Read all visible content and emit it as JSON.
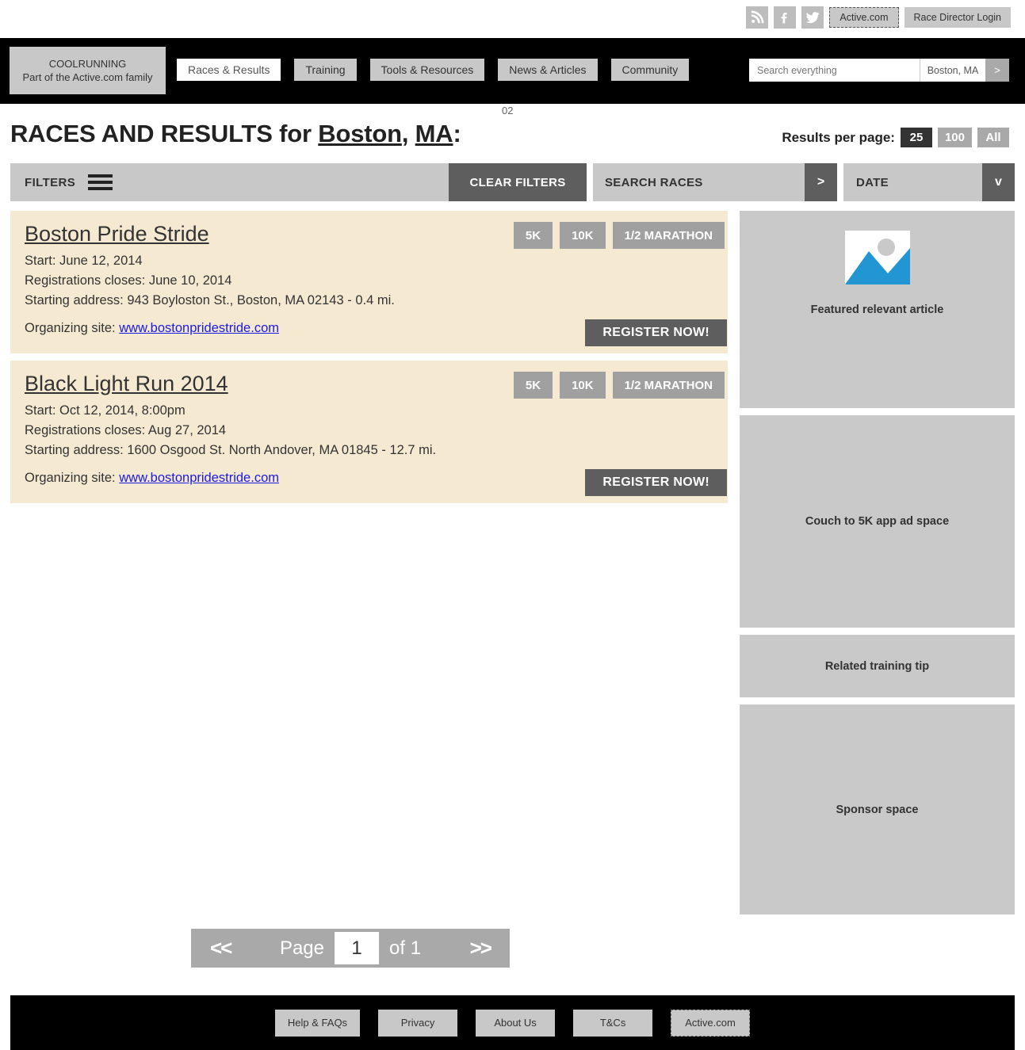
{
  "utility": {
    "social": [
      {
        "name": "rss-icon",
        "label": "RSS"
      },
      {
        "name": "facebook-icon",
        "label": "Facebook"
      },
      {
        "name": "twitter-icon",
        "label": "Twitter"
      }
    ],
    "active_button": "Active.com",
    "race_director_login": "Race Director Login"
  },
  "nav": {
    "logo_line1": "COOLRUNNING",
    "logo_line2": "Part of the Active.com family",
    "items": [
      {
        "label": "Races & Results",
        "active": true
      },
      {
        "label": "Training",
        "active": false
      },
      {
        "label": "Tools & Resources",
        "active": false
      },
      {
        "label": "News & Articles",
        "active": false
      },
      {
        "label": "Community",
        "active": false
      }
    ],
    "artifact_text": "02",
    "search_placeholder": "Search everything",
    "search_value": "",
    "location": "Boston, MA",
    "go_label": ">"
  },
  "header": {
    "title_prefix": "RACES AND RESULTS for ",
    "title_city": "Boston",
    "title_comma": ", ",
    "title_state": "MA",
    "title_suffix": ":",
    "results_per_page_label": "Results per page:",
    "results_per_page_options": [
      {
        "label": "25",
        "selected": true
      },
      {
        "label": "100",
        "selected": false
      },
      {
        "label": "All",
        "selected": false
      }
    ]
  },
  "filters": {
    "filters_label": "FILTERS",
    "clear_filters_label": "CLEAR FILTERS",
    "search_races_label": "SEARCH RACES",
    "search_races_go": ">",
    "date_label": "DATE",
    "date_caret": "v"
  },
  "races": [
    {
      "title": "Boston Pride Stride",
      "start": "Start: June 12, 2014",
      "registration": "Registrations closes: June 10, 2014",
      "address": "Starting address: 943 Boyloston St., Boston, MA 02143 - 0.4 mi.",
      "org_label": "Organizing site: ",
      "org_link": "www.bostonpridestride.com",
      "badges": [
        "5K",
        "10K",
        "1/2 MARATHON"
      ],
      "register_label": "REGISTER NOW!"
    },
    {
      "title": "Black Light Run 2014",
      "start": "Start: Oct 12, 2014, 8:00pm",
      "registration": "Registrations closes: Aug 27, 2014",
      "address": "Starting address: 1600 Osgood St. North Andover, MA 01845 - 12.7 mi.",
      "org_label": "Organizing site: ",
      "org_link": "www.bostonpridestride.com",
      "badges": [
        "5K",
        "10K",
        "1/2 MARATHON"
      ],
      "register_label": "REGISTER NOW!"
    }
  ],
  "sidebar": {
    "panels": [
      {
        "label": "Featured relevant article",
        "type": "article"
      },
      {
        "label": "Couch to 5K app ad space",
        "type": "ad"
      },
      {
        "label": "Related training tip",
        "type": "tip"
      },
      {
        "label": "Sponsor space",
        "type": "sponsor"
      }
    ]
  },
  "pagination": {
    "prev": "<<",
    "page_label": "Page",
    "page_value": "1",
    "of_label": "of  1",
    "next": ">>"
  },
  "footer": {
    "links": [
      {
        "label": "Help & FAQs",
        "dashed": false
      },
      {
        "label": "Privacy",
        "dashed": false
      },
      {
        "label": "About Us",
        "dashed": false
      },
      {
        "label": "T&Cs",
        "dashed": false
      },
      {
        "label": "Active.com",
        "dashed": true
      }
    ]
  },
  "colors": {
    "brand_black": "#000000",
    "card_cream": "#f6e9d2",
    "gray_panel": "#c9c9c9",
    "dark_button": "#5e5e5e",
    "link_blue": "#1a1ae6",
    "placeholder_blue": "#2196d3"
  }
}
